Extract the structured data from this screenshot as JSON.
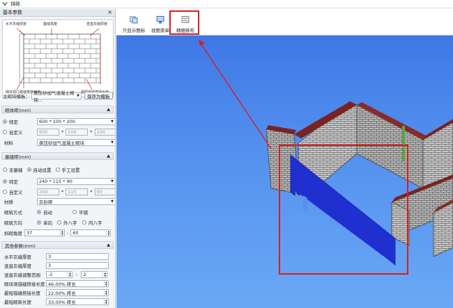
{
  "window": {
    "title": "排砖"
  },
  "panel": {
    "header": "基本参数",
    "diagram_labels": {
      "horizontal_joint": "水平灰缝厚度",
      "mortar_height": "塞缝高度",
      "vertical_joint": "竖直灰缝厚度",
      "hole_lap": "砌块洞口错缝搭接长度",
      "min_lap": "最短错缝搭接长度"
    },
    "template_label": "主砌块模板：",
    "template_value": "蒸压砂加气混凝土砌块...",
    "save_template": "保存为模板"
  },
  "block": {
    "header": "砌体砖(mm)",
    "spec_label": "特定",
    "spec_value": "600 * 100 * 200",
    "custom_label": "自定义",
    "custom_w": "600",
    "custom_h": "100",
    "custom_d": "200",
    "material_label": "材料",
    "material_value": "蒸压砂加气混凝土砌块"
  },
  "plug": {
    "header": "塞缝砖(mm)",
    "opt_none": "无塞缝",
    "opt_auto": "自动设置",
    "opt_manual": "手工设置",
    "spec_label": "特定",
    "spec_value": "240 * 115 * 90",
    "custom_label": "自定义",
    "custom_w": "240",
    "custom_h": "115",
    "custom_d": "90",
    "material_label": "材质",
    "material_value": "灰砂砖",
    "method_label": "砌筑方式",
    "method_auto": "自动",
    "method_flat": "平铺",
    "dir_label": "砌筑方向",
    "dir_single": "单向",
    "dir_out": "外八字",
    "dir_in": "内八字",
    "angle_label": "斜砌角度",
    "angle_min": "37",
    "angle_max": "60"
  },
  "other": {
    "header": "其他参数(mm)",
    "rows": [
      {
        "label": "水平灰缝厚度",
        "value": "3"
      },
      {
        "label": "竖直灰缝厚度",
        "value": "3"
      },
      {
        "label": "竖直灰缝调整范围",
        "value": "-2",
        "value2": "2"
      },
      {
        "label": "砌块洞错缝搭接长度",
        "value": "46.00% 砖长"
      },
      {
        "label": "最短错缝搭接长度",
        "value": "22.00% 砖长"
      },
      {
        "label": "最短砌筑长度",
        "value": "33.00% 砖长"
      }
    ]
  },
  "toolbar": {
    "show_icons": "只显示图标",
    "view_menu": "视图菜单",
    "fine_layout": "精细排布"
  },
  "colors": {
    "viewport": "#4a86ec",
    "highlight": "#d81e1e",
    "blue_wall": "#1f2fd0"
  }
}
